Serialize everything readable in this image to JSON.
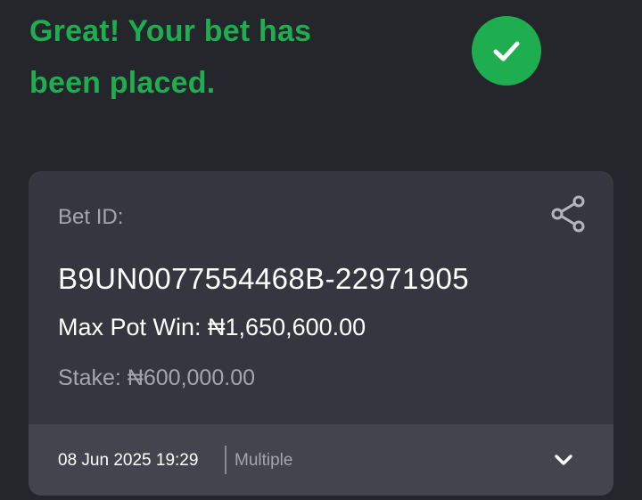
{
  "header": {
    "line1": "Great! Your bet has",
    "line2": "been placed.",
    "status_icon": "check-circle-icon",
    "accent_color": "#1fae4f"
  },
  "bet": {
    "id_label": "Bet ID:",
    "id_value": "B9UN0077554468B-22971905",
    "max_pot_win": "Max Pot Win: ₦1,650,600.00",
    "stake": "Stake: ₦600,000.00",
    "share_icon": "share-icon"
  },
  "footer": {
    "date": "08 Jun 2025 19:29",
    "type": "Multiple",
    "expand_icon": "chevron-down-icon"
  }
}
